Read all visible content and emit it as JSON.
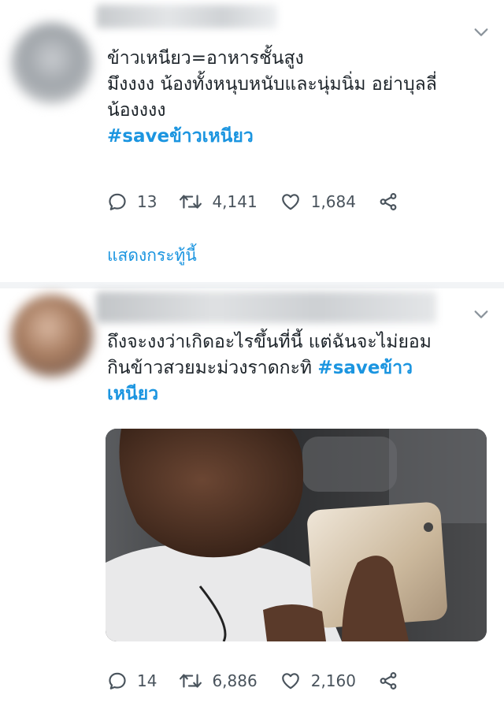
{
  "tweets": [
    {
      "text_lines": [
        "ข้าวเหนียว=อาหารชั้นสูง",
        "มึงงงง น้องทั้งหนุบหนับและนุ่มนิ่ม อย่าบุลลี่",
        "น้องงงง"
      ],
      "hashtag": "#saveข้าวเหนียว",
      "replies": "13",
      "retweets": "4,141",
      "likes": "1,684",
      "show_thread": "แสดงกระทู้นี้"
    },
    {
      "text_lines": [
        "ถึงจะงงว่าเกิดอะไรขึ้นที่นี้ แต่ฉันจะไม่ยอม",
        "กินข้าวสวยมะม่วงราดกะทิ "
      ],
      "hashtag_part1": "#saveข้าว",
      "hashtag_part2": "เหนียว",
      "replies": "14",
      "retweets": "6,886",
      "likes": "2,160"
    }
  ],
  "colors": {
    "link": "#1b95e0",
    "text": "#1c2329",
    "icon": "#49535c",
    "background": "#f2f4f6"
  },
  "icons": [
    "chevron-down-icon",
    "reply-icon",
    "retweet-icon",
    "like-icon",
    "share-icon"
  ]
}
